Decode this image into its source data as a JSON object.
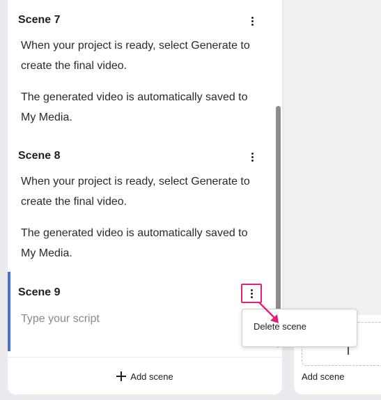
{
  "scenes": [
    {
      "title": "Scene 7",
      "paragraphs": [
        "When your project is ready, select Generate to create the final video.",
        "The generated video is automatically saved to My Media."
      ]
    },
    {
      "title": "Scene 8",
      "paragraphs": [
        "When your project is ready, select Generate to create the final video.",
        "The generated video is automatically saved to My Media."
      ]
    },
    {
      "title": "Scene 9",
      "placeholder": "Type your script"
    }
  ],
  "add_scene_label": "Add scene",
  "right_panel": {
    "add_scene_label": "Add scene"
  },
  "popup_menu": {
    "items": [
      "Delete scene"
    ]
  },
  "colors": {
    "active_scene": "#4a6ee0",
    "highlight": "#e0217a"
  },
  "icons": {
    "more": "more-vertical-icon",
    "add": "plus-icon"
  }
}
